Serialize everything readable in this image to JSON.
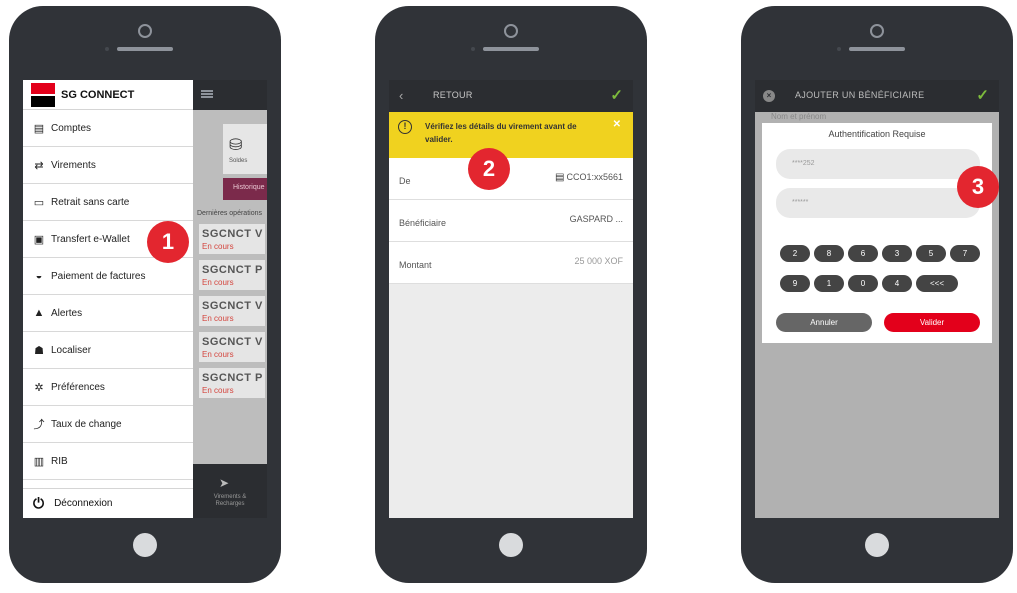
{
  "phone1": {
    "brand": "SG CONNECT",
    "menu": [
      {
        "label": "Comptes",
        "icon": "accounts-icon"
      },
      {
        "label": "Virements",
        "icon": "transfer-icon"
      },
      {
        "label": "Retrait sans carte",
        "icon": "cardless-withdrawal-icon"
      },
      {
        "label": "Transfert e-Wallet",
        "icon": "wallet-icon"
      },
      {
        "label": "Paiement de factures",
        "icon": "bill-payment-icon"
      },
      {
        "label": "Alertes",
        "icon": "bell-icon"
      },
      {
        "label": "Localiser",
        "icon": "people-icon"
      },
      {
        "label": "Préférences",
        "icon": "gear-icon"
      },
      {
        "label": "Taux de change",
        "icon": "exchange-icon"
      },
      {
        "label": "RIB",
        "icon": "document-icon"
      }
    ],
    "logout": "Déconnexion",
    "badge": "1",
    "background": {
      "card_label": "Soldes",
      "history_button": "Historique",
      "section_title": "Dernières opérations",
      "operations": [
        {
          "name": "SGCNCT V",
          "status": "En cours"
        },
        {
          "name": "SGCNCT P",
          "status": "En cours"
        },
        {
          "name": "SGCNCT V",
          "status": "En cours"
        },
        {
          "name": "SGCNCT V",
          "status": "En cours"
        },
        {
          "name": "SGCNCT P",
          "status": "En cours"
        }
      ],
      "bottom_tab": "Virements & Recharges"
    }
  },
  "phone2": {
    "title": "RETOUR",
    "warning": "Vérifiez les détails du virement avant de valider.",
    "badge": "2",
    "rows": [
      {
        "label": "De",
        "value": "CCO1:xx5661"
      },
      {
        "label": "Bénéficiaire",
        "value": "GASPARD ..."
      },
      {
        "label": "Montant",
        "value": "25 000 XOF"
      }
    ]
  },
  "phone3": {
    "title": "AJOUTER UN BÉNÉFICIAIRE",
    "background_text": "Nom et prénom",
    "modal_title": "Authentification Requise",
    "field1": "****252",
    "field2": "******",
    "keys_row1": [
      "2",
      "8",
      "6",
      "3",
      "5",
      "7"
    ],
    "keys_row2": [
      "9",
      "1",
      "0",
      "4",
      "<<<"
    ],
    "cancel": "Annuler",
    "confirm": "Valider",
    "badge": "3"
  },
  "colors": {
    "brand_red": "#e3001b",
    "warning_yellow": "#f0d21f",
    "check_green": "#7dbb3c",
    "device": "#303338"
  }
}
